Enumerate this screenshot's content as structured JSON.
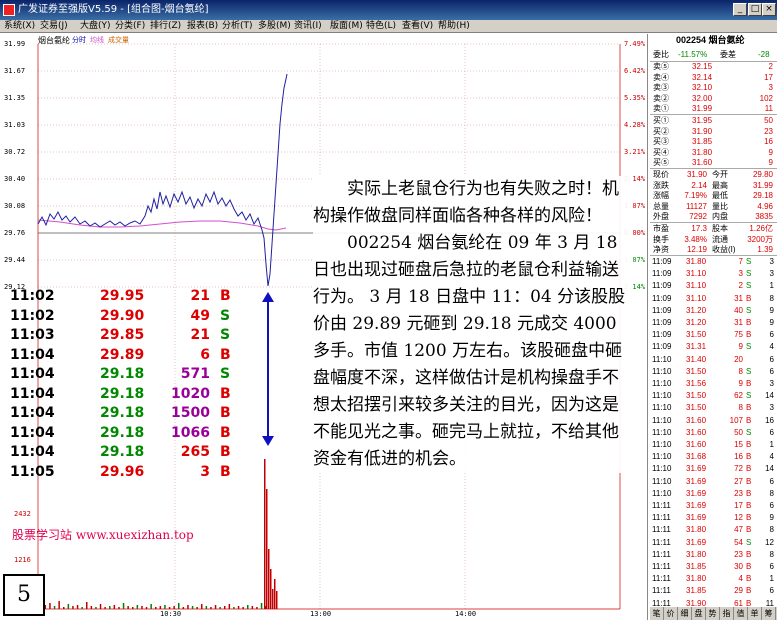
{
  "window": {
    "title": "广发证券至强版V5.59 - [组合图-烟台氨纶]",
    "minimize": "_",
    "restore": "□",
    "close": "×"
  },
  "menu": [
    "系统(X)",
    "交易(J)",
    "大盘(Y)",
    "分类(F)",
    "排行(Z)",
    "报表(B)",
    "分析(T)",
    "多股(M)",
    "资讯(I)",
    "版面(M)",
    "特色(L)",
    "查看(V)",
    "帮助(H)"
  ],
  "chart": {
    "stock_name": "烟台氨纶",
    "legend": [
      "分时",
      "均线",
      "成交量"
    ],
    "price_labels": [
      "31.99",
      "31.67",
      "31.35",
      "31.03",
      "30.72",
      "30.40",
      "30.08",
      "29.76",
      "29.44",
      "29.12"
    ],
    "pct_labels": [
      "7.49%",
      "6.42%",
      "5.35%",
      "4.28%",
      "3.21%",
      "2.14%",
      "1.07%",
      "0.00%",
      "1.07%",
      "2.14%"
    ],
    "vol_labels": [
      "2432",
      "1216"
    ],
    "time_labels": [
      "10:30",
      "13:00",
      "14:00"
    ],
    "colors": {
      "price_line": "#2020a0",
      "avg_line": "#d050d0",
      "up": "#c00000",
      "down": "#008000"
    }
  },
  "trades": [
    {
      "time": "11:02",
      "price": "29.95",
      "vol": "21",
      "side": "B",
      "pc": "red",
      "vc": "red"
    },
    {
      "time": "11:02",
      "price": "29.90",
      "vol": "49",
      "side": "S",
      "pc": "red",
      "vc": "red"
    },
    {
      "time": "11:03",
      "price": "29.85",
      "vol": "21",
      "side": "S",
      "pc": "red",
      "vc": "red"
    },
    {
      "time": "11:04",
      "price": "29.89",
      "vol": "6",
      "side": "B",
      "pc": "red",
      "vc": "red"
    },
    {
      "time": "11:04",
      "price": "29.18",
      "vol": "571",
      "side": "S",
      "pc": "grn",
      "vc": "pur"
    },
    {
      "time": "11:04",
      "price": "29.18",
      "vol": "1020",
      "side": "B",
      "pc": "grn",
      "vc": "pur"
    },
    {
      "time": "11:04",
      "price": "29.18",
      "vol": "1500",
      "side": "B",
      "pc": "grn",
      "vc": "pur"
    },
    {
      "time": "11:04",
      "price": "29.18",
      "vol": "1066",
      "side": "B",
      "pc": "grn",
      "vc": "pur"
    },
    {
      "time": "11:04",
      "price": "29.18",
      "vol": "265",
      "side": "B",
      "pc": "grn",
      "vc": "red"
    },
    {
      "time": "11:05",
      "price": "29.96",
      "vol": "3",
      "side": "B",
      "pc": "red",
      "vc": "red"
    }
  ],
  "article": {
    "p1": "实际上老鼠仓行为也有失败之时！机构操作做盘同样面临各种各样的风险！",
    "p2": "002254 烟台氨纶在 09 年 3 月 18 日也出现过砸盘后急拉的老鼠仓利益输送行为。 3 月 18 日盘中 11：04 分该股股价由 29.89 元砸到 29.18 元成交 4000 多手。市值 1200 万左右。该股砸盘中砸盘幅度不深，这样做估计是机构操盘手不想太招摆引来较多关注的目光，因为这是不能见光之事。砸完马上就拉，不给其他资金有低进的机会。"
  },
  "watermark": "股票学习站  www.xuexizhan.top",
  "page_number": "5",
  "quote": {
    "header": "002254 烟台氨纶",
    "weibi_label": "委比",
    "weibi": "-11.57%",
    "weicha_label": "委差",
    "weicha": "-28",
    "asks": [
      {
        "label": "卖⑤",
        "price": "32.15",
        "vol": "2"
      },
      {
        "label": "卖④",
        "price": "32.14",
        "vol": "17"
      },
      {
        "label": "卖③",
        "price": "32.10",
        "vol": "3"
      },
      {
        "label": "卖②",
        "price": "32.00",
        "vol": "102"
      },
      {
        "label": "卖①",
        "price": "31.99",
        "vol": "11"
      }
    ],
    "bids": [
      {
        "label": "买①",
        "price": "31.95",
        "vol": "50"
      },
      {
        "label": "买②",
        "price": "31.90",
        "vol": "23"
      },
      {
        "label": "买③",
        "price": "31.85",
        "vol": "16"
      },
      {
        "label": "买④",
        "price": "31.80",
        "vol": "9"
      },
      {
        "label": "买⑤",
        "price": "31.60",
        "vol": "9"
      }
    ],
    "stats": [
      {
        "l1": "现价",
        "v1": "31.90",
        "l2": "今开",
        "v2": "29.80"
      },
      {
        "l1": "涨跌",
        "v1": "2.14",
        "l2": "最高",
        "v2": "31.99"
      },
      {
        "l1": "涨幅",
        "v1": "7.19%",
        "l2": "最低",
        "v2": "29.18"
      },
      {
        "l1": "总量",
        "v1": "11127",
        "l2": "量比",
        "v2": "4.96"
      },
      {
        "l1": "外盘",
        "v1": "7292",
        "l2": "内盘",
        "v2": "3835"
      }
    ],
    "stats2": [
      {
        "l1": "市盈",
        "v1": "17.3",
        "l2": "股本",
        "v2": "1.26亿"
      },
      {
        "l1": "换手",
        "v1": "3.48%",
        "l2": "流通",
        "v2": "3200万"
      },
      {
        "l1": "净资",
        "v1": "12.19",
        "l2": "收益(I)",
        "v2": "1.39"
      }
    ],
    "ticks": [
      [
        "11:09",
        "31.80",
        "7",
        "S",
        "3"
      ],
      [
        "11:09",
        "31.10",
        "3",
        "S",
        "3"
      ],
      [
        "11:09",
        "31.10",
        "2",
        "S",
        "1"
      ],
      [
        "11:09",
        "31.10",
        "31",
        "B",
        "8"
      ],
      [
        "11:09",
        "31.20",
        "40",
        "S",
        "9"
      ],
      [
        "11:09",
        "31.20",
        "31",
        "B",
        "9"
      ],
      [
        "11:09",
        "31.50",
        "75",
        "B",
        "6"
      ],
      [
        "11:09",
        "31.31",
        "9",
        "S",
        "4"
      ],
      [
        "11:10",
        "31.40",
        "20",
        "",
        "6"
      ],
      [
        "11:10",
        "31.50",
        "8",
        "S",
        "6"
      ],
      [
        "11:10",
        "31.56",
        "9",
        "B",
        "3"
      ],
      [
        "11:10",
        "31.50",
        "62",
        "S",
        "14"
      ],
      [
        "11:10",
        "31.50",
        "8",
        "B",
        "3"
      ],
      [
        "11:10",
        "31.60",
        "107",
        "B",
        "16"
      ],
      [
        "11:10",
        "31.60",
        "50",
        "S",
        "6"
      ],
      [
        "11:10",
        "31.60",
        "15",
        "B",
        "1"
      ],
      [
        "11:10",
        "31.68",
        "16",
        "B",
        "4"
      ],
      [
        "11:10",
        "31.69",
        "72",
        "B",
        "14"
      ],
      [
        "11:10",
        "31.69",
        "27",
        "B",
        "6"
      ],
      [
        "11:10",
        "31.69",
        "23",
        "B",
        "8"
      ],
      [
        "11:11",
        "31.69",
        "17",
        "B",
        "6"
      ],
      [
        "11:11",
        "31.69",
        "12",
        "B",
        "9"
      ],
      [
        "11:11",
        "31.80",
        "47",
        "B",
        "8"
      ],
      [
        "11:11",
        "31.69",
        "54",
        "S",
        "12"
      ],
      [
        "11:11",
        "31.80",
        "23",
        "B",
        "8"
      ],
      [
        "11:11",
        "31.85",
        "30",
        "B",
        "6"
      ],
      [
        "11:11",
        "31.80",
        "4",
        "B",
        "1"
      ],
      [
        "11:11",
        "31.85",
        "29",
        "B",
        "6"
      ],
      [
        "11:11",
        "31.90",
        "61",
        "B",
        "11"
      ],
      [
        "11:11",
        "31.90",
        "3",
        "S",
        "2"
      ]
    ],
    "tabs": [
      "笔",
      "价",
      "细",
      "盘",
      "势",
      "指",
      "值",
      "单",
      "筹"
    ]
  }
}
